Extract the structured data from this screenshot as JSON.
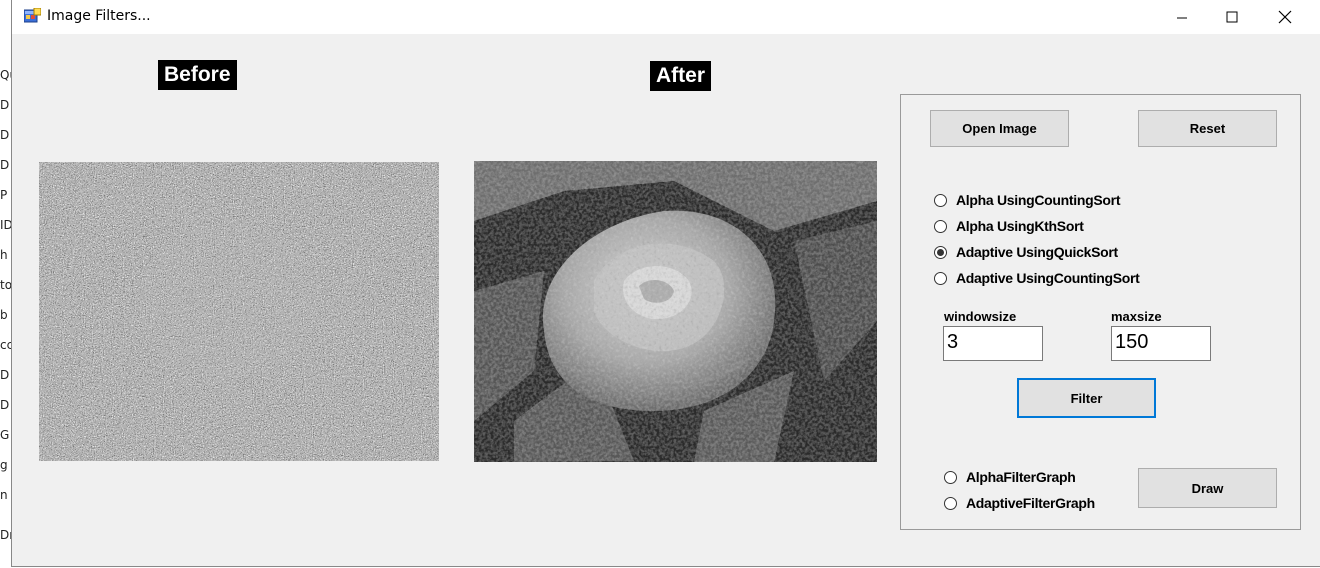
{
  "background_strip": [
    "Qu",
    "D",
    "D",
    "D",
    "P",
    "ID",
    "h",
    "to",
    "b",
    "cc",
    "D",
    "D",
    "G",
    "g",
    "n",
    "Dn"
  ],
  "window": {
    "title": "Image Filters..."
  },
  "labels": {
    "before": "Before",
    "after": "After"
  },
  "buttons": {
    "open_image": "Open Image",
    "reset": "Reset",
    "filter": "Filter",
    "draw": "Draw"
  },
  "filter_options": [
    {
      "label": "Alpha UsingCountingSort",
      "selected": false
    },
    {
      "label": "Alpha UsingKthSort",
      "selected": false
    },
    {
      "label": "Adaptive UsingQuickSort",
      "selected": true
    },
    {
      "label": "Adaptive UsingCountingSort",
      "selected": false
    }
  ],
  "fields": {
    "windowsize": {
      "label": "windowsize",
      "value": "3"
    },
    "maxsize": {
      "label": "maxsize",
      "value": "150"
    }
  },
  "graph_options": [
    {
      "label": "AlphaFilterGraph",
      "selected": false
    },
    {
      "label": "AdaptiveFilterGraph",
      "selected": false
    }
  ],
  "colors": {
    "window_bg": "#f0f0f0",
    "focus_border": "#0078d7",
    "label_bg": "#000000"
  }
}
